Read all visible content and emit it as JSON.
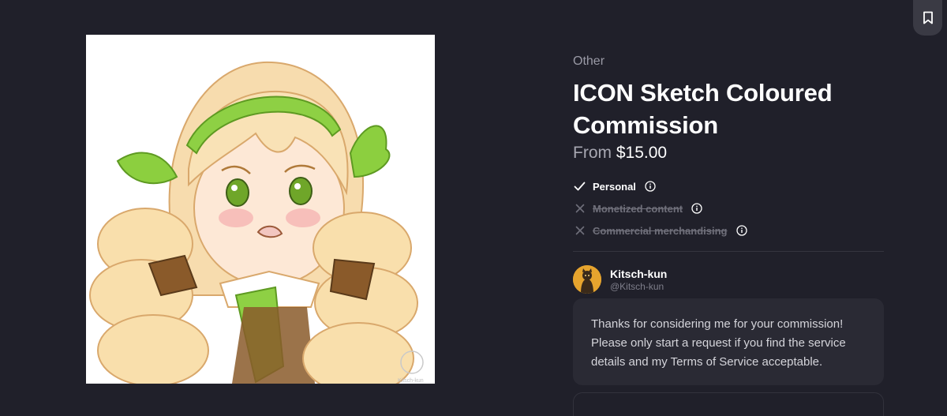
{
  "listing": {
    "category": "Other",
    "title": "ICON Sketch Coloured Commission",
    "price_prefix": "From",
    "price_value": "$15.00"
  },
  "artwork": {
    "signature": "Kitsch-kun"
  },
  "licenses": [
    {
      "label": "Personal",
      "allowed": true,
      "mark_icon": "check-icon",
      "info_icon": "info-icon"
    },
    {
      "label": "Monetized content",
      "allowed": false,
      "mark_icon": "cross-icon",
      "info_icon": "info-icon"
    },
    {
      "label": "Commercial merchandising",
      "allowed": false,
      "mark_icon": "cross-icon",
      "info_icon": "info-icon"
    }
  ],
  "artist": {
    "name": "Kitsch-kun",
    "handle": "@Kitsch-kun"
  },
  "message": "Thanks for considering me for your commission! Please only start a request if you find the service details and my Terms of Service acceptable.",
  "icons": {
    "bookmark": "bookmark-icon"
  },
  "colors": {
    "page_background": "#20202a",
    "card_background": "#2a2a34",
    "muted_text": "#9a9aa6",
    "denied_text": "#6f6f7a"
  }
}
